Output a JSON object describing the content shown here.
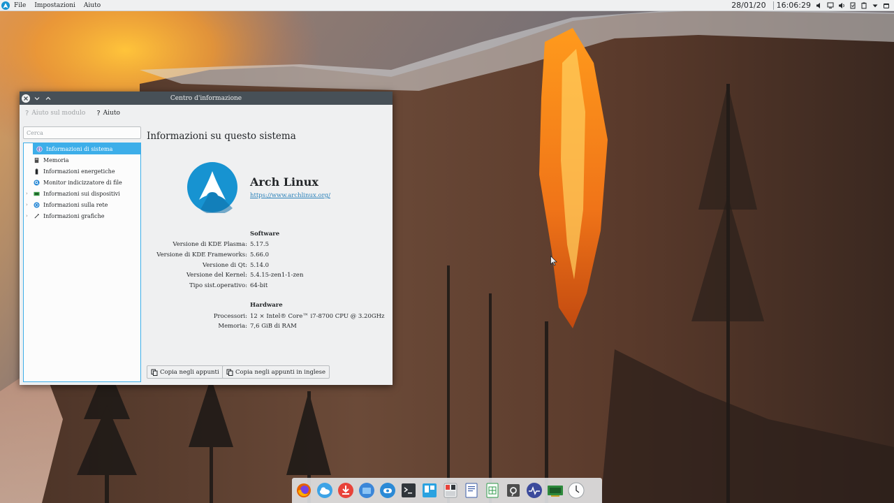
{
  "top_panel": {
    "launcher_icon": "arch-launcher-icon",
    "menu": [
      "File",
      "Impostazioni",
      "Aiuto"
    ],
    "date": "28/01/20",
    "time": "16:06:29",
    "tray_icons": [
      "volume-icon",
      "network-icon",
      "speaker-icon",
      "updates-icon",
      "clipboard-icon",
      "expand-tray-icon",
      "battery-icon"
    ]
  },
  "window": {
    "title": "Centro d'informazione",
    "toolbar": {
      "module_help": "Aiuto sul modulo",
      "help": "Aiuto"
    },
    "search_placeholder": "Cerca",
    "sidebar": [
      {
        "label": "Informazioni di sistema",
        "icon": "info-icon",
        "expandable": false,
        "selected": true
      },
      {
        "label": "Memoria",
        "icon": "memory-icon",
        "expandable": false,
        "selected": false
      },
      {
        "label": "Informazioni energetiche",
        "icon": "battery-icon",
        "expandable": false,
        "selected": false
      },
      {
        "label": "Monitor indicizzatore di file",
        "icon": "search-indexer-icon",
        "expandable": false,
        "selected": false
      },
      {
        "label": "Informazioni sui dispositivi",
        "icon": "devices-icon",
        "expandable": true,
        "selected": false
      },
      {
        "label": "Informazioni sulla rete",
        "icon": "network-icon",
        "expandable": true,
        "selected": false
      },
      {
        "label": "Informazioni grafiche",
        "icon": "graphics-icon",
        "expandable": true,
        "selected": false
      }
    ],
    "main": {
      "heading": "Informazioni su questo sistema",
      "distro_name": "Arch Linux",
      "distro_url": "https://www.archlinux.org/",
      "software_title": "Software",
      "software": [
        {
          "key": "Versione di KDE Plasma:",
          "value": "5.17.5"
        },
        {
          "key": "Versione di KDE Frameworks:",
          "value": "5.66.0"
        },
        {
          "key": "Versione di Qt:",
          "value": "5.14.0"
        },
        {
          "key": "Versione del Kernel:",
          "value": "5.4.15-zen1-1-zen"
        },
        {
          "key": "Tipo sist.operativo:",
          "value": "64-bit"
        }
      ],
      "hardware_title": "Hardware",
      "hardware": [
        {
          "key": "Processori:",
          "value": "12 × Intel® Core™ i7-8700 CPU @ 3.20GHz"
        },
        {
          "key": "Memoria:",
          "value": "7,6 GiB di RAM"
        }
      ],
      "copy_button": "Copia negli appunti",
      "copy_english_button": "Copia negli appunti in inglese"
    }
  },
  "dock": [
    "firefox-icon",
    "weather-icon",
    "download-icon",
    "file-manager-icon",
    "chat-icon",
    "terminal-icon",
    "kanban-icon",
    "calculator-icon",
    "text-editor-icon",
    "spreadsheet-icon",
    "settings-icon",
    "system-monitor-icon",
    "hardware-info-icon",
    "clock-icon"
  ],
  "colors": {
    "accent": "#3daee9",
    "titlebar": "#475057",
    "arch_blue": "#1793d1",
    "window_bg": "#eff0f1"
  }
}
